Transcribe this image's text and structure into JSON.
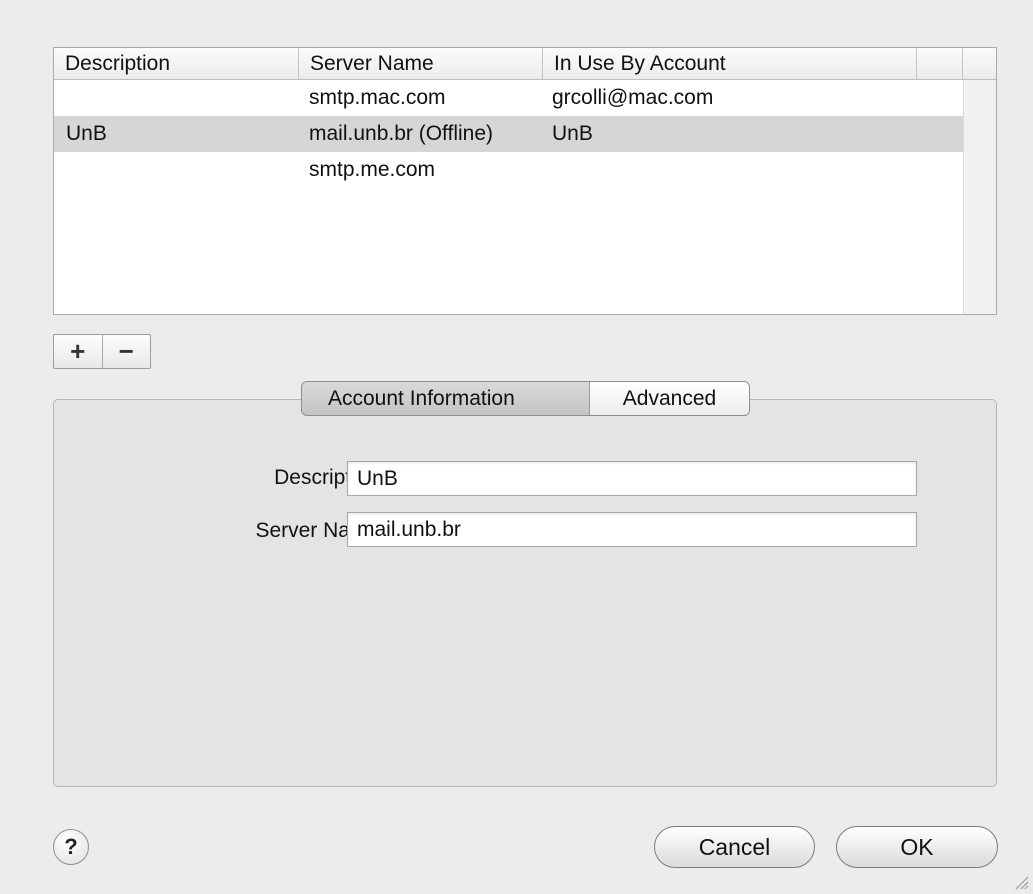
{
  "table": {
    "columns": [
      "Description",
      "Server Name",
      "In Use By Account"
    ],
    "rows": [
      {
        "description": "",
        "server": "smtp.mac.com",
        "account": "grcolli@mac.com"
      },
      {
        "description": "UnB",
        "server": "mail.unb.br (Offline)",
        "account": "UnB"
      },
      {
        "description": "",
        "server": "smtp.me.com",
        "account": ""
      }
    ]
  },
  "list_controls": {
    "add": "+",
    "remove": "−"
  },
  "tabs": [
    "Account Information",
    "Advanced"
  ],
  "form": {
    "description_label": "Description:",
    "description_value": "UnB",
    "server_label": "Server Name:",
    "server_value": "mail.unb.br"
  },
  "footer": {
    "help": "?",
    "cancel": "Cancel",
    "ok": "OK"
  }
}
